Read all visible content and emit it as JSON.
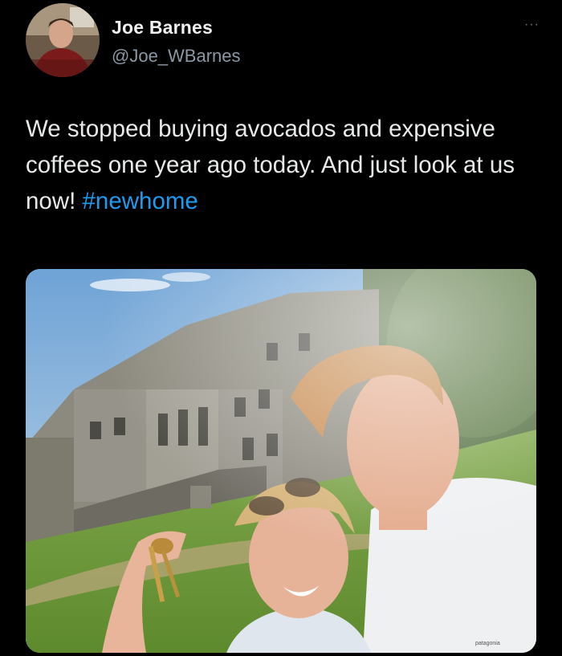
{
  "tweet": {
    "author": {
      "name": "Joe Barnes",
      "handle": "@Joe_WBarnes",
      "avatar_icon": "profile-photo"
    },
    "more_label": "···",
    "text_before": "We stopped buying avocados and expensive coffees one year ago today. And just look at us now! ",
    "hashtag": "#newhome",
    "media": {
      "shirt_logo": "patagonia"
    }
  },
  "colors": {
    "background": "#000000",
    "text": "#e7e9ea",
    "secondary": "#8b98a5",
    "link": "#1d9bf0"
  }
}
